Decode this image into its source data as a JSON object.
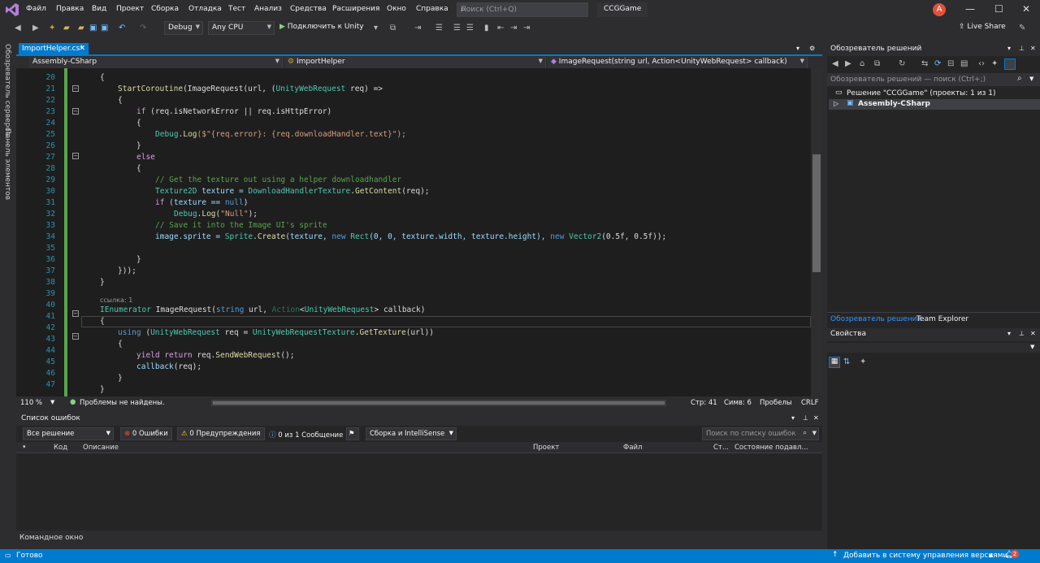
{
  "menu": {
    "items": [
      "Файл",
      "Правка",
      "Вид",
      "Проект",
      "Сборка",
      "Отладка",
      "Тест",
      "Анализ",
      "Средства",
      "Расширения",
      "Окно",
      "Справка"
    ],
    "search_placeholder": "Поиск (Ctrl+Q)",
    "solution_name": "CCGGame",
    "avatar_letter": "A"
  },
  "toolbar": {
    "config": "Debug",
    "platform": "Any CPU",
    "run_label": "Подключить к Unity",
    "live_share": "Live Share"
  },
  "left_rail": {
    "server_explorer": "Обозреватель серверов",
    "toolbox": "Панель элементов"
  },
  "editor": {
    "tab_label": "ImportHelper.cs*",
    "nav_project": "Assembly-CSharp",
    "nav_class": "ImportHelper",
    "nav_member": "ImageRequest(string url, Action<UnityWebRequest> callback)",
    "ref_hint": "ссылка: 1",
    "line_numbers": [
      "20",
      "21",
      "22",
      "23",
      "24",
      "25",
      "26",
      "27",
      "28",
      "29",
      "30",
      "31",
      "32",
      "33",
      "34",
      "35",
      "36",
      "37",
      "38",
      "39",
      "40",
      "41",
      "42",
      "43",
      "44",
      "45",
      "46",
      "47"
    ],
    "code": {
      "l21": {
        "a": "StartCoroutine",
        "b": "(ImageRequest(url, (",
        "c": "UnityWebRequest",
        "d": " req) =>"
      },
      "l23": {
        "a": "if",
        "b": " (req.isNetworkError || req.isHttpError)"
      },
      "l25": {
        "a": "Debug",
        "b": ".",
        "c": "Log",
        "d": "($\"{req.error}: {req.downloadHandler.text}\");"
      },
      "l27": {
        "a": "else"
      },
      "l29": {
        "a": "// Get the texture out using a helper downloadhandler"
      },
      "l30": {
        "a": "Texture2D",
        "b": " texture = ",
        "c": "DownloadHandlerTexture",
        "d": ".",
        "e": "GetContent",
        "f": "(req);"
      },
      "l31": {
        "a": "if",
        "b": " (texture == ",
        "c": "null",
        "d": ")"
      },
      "l32": {
        "a": "Debug",
        "b": ".",
        "c": "Log",
        "d": "(",
        "e": "\"Null\"",
        "f": ");"
      },
      "l33": {
        "a": "// Save it into the Image UI's sprite"
      },
      "l34": {
        "a": "image.sprite = ",
        "b": "Sprite",
        "c": ".",
        "d": "Create",
        "e": "(texture, ",
        "f": "new",
        "g": " ",
        "h": "Rect",
        "i": "(0, 0, texture.width, texture.height), ",
        "j": "new",
        "k": " ",
        "l": "Vector2",
        "m": "(0.5f, 0.5f));"
      },
      "l40": {
        "a": "IEnumerator",
        "b": " ImageRequest(",
        "c": "string",
        "d": " url, ",
        "e": "Action",
        "f": "<",
        "g": "UnityWebRequest",
        "h": "> callback)"
      },
      "l42": {
        "a": "using",
        "b": " (",
        "c": "UnityWebRequest",
        "d": " req = ",
        "e": "UnityWebRequestTexture",
        "f": ".",
        "g": "GetTexture",
        "h": "(url))"
      },
      "l44": {
        "a": "yield return",
        "b": " req.",
        "c": "SendWebRequest",
        "d": "();"
      },
      "l45": {
        "a": "callback",
        "b": "(req);"
      }
    },
    "status": {
      "zoom": "110 %",
      "issues": "Проблемы не найдены.",
      "line": "Стр: 41",
      "col": "Симв: 6",
      "spaces": "Пробелы",
      "eol": "CRLF"
    }
  },
  "error_list": {
    "title": "Список ошибок",
    "scope": "Все решение",
    "errors": "0 Ошибки",
    "warnings": "0 Предупреждения",
    "messages": "0 из 1 Сообщение",
    "build_filter": "Сборка и IntelliSense",
    "search_placeholder": "Поиск по списку ошибок",
    "columns": [
      "Код",
      "Описание",
      "Проект",
      "Файл",
      "Ст...",
      "Состояние подавл..."
    ]
  },
  "command_window": "Командное окно",
  "statusbar": {
    "ready": "Готово",
    "source_control": "Добавить в систему управления версиями",
    "notif_count": "2"
  },
  "solution_explorer": {
    "title": "Обозреватель решений",
    "search_placeholder": "Обозреватель решений — поиск (Ctrl+;)",
    "solution_node": "Решение \"CCGGame\" (проекты: 1 из 1)",
    "project_node": "Assembly-CSharp",
    "tab_solution": "Обозреватель решений",
    "tab_team": "Team Explorer"
  },
  "properties": {
    "title": "Свойства"
  }
}
